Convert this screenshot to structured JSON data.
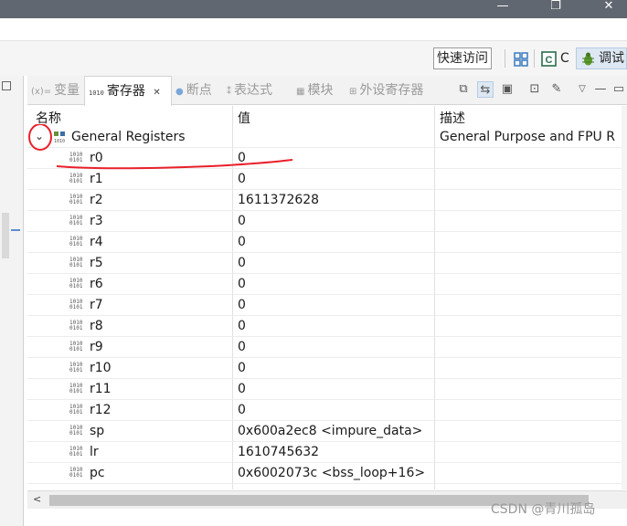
{
  "window": {
    "minimize": "—",
    "restore": "❐",
    "close": "✕"
  },
  "toolbar": {
    "quick_access": "快速访问",
    "perspectives": [
      {
        "icon": "c-perspective-icon",
        "label": "C"
      },
      {
        "icon": "debug-bug-icon",
        "label": "调试"
      }
    ]
  },
  "tabs": [
    {
      "icon": "(x)=",
      "label": "变量"
    },
    {
      "icon": "1010",
      "label": "寄存器",
      "close": "✕"
    },
    {
      "icon": "●",
      "label": "断点"
    },
    {
      "icon": "⁑",
      "label": "表达式"
    },
    {
      "icon": "▦",
      "label": "模块"
    },
    {
      "icon": "⊞",
      "label": "外设寄存器"
    }
  ],
  "table": {
    "headers": {
      "name": "名称",
      "value": "值",
      "description": "描述"
    },
    "group": {
      "expand_icon": "⌄",
      "name": "General Registers",
      "description": "General Purpose and FPU R"
    },
    "rows": [
      {
        "name": "r0",
        "value": "0"
      },
      {
        "name": "r1",
        "value": "0"
      },
      {
        "name": "r2",
        "value": "1611372628"
      },
      {
        "name": "r3",
        "value": "0"
      },
      {
        "name": "r4",
        "value": "0"
      },
      {
        "name": "r5",
        "value": "0"
      },
      {
        "name": "r6",
        "value": "0"
      },
      {
        "name": "r7",
        "value": "0"
      },
      {
        "name": "r8",
        "value": "0"
      },
      {
        "name": "r9",
        "value": "0"
      },
      {
        "name": "r10",
        "value": "0"
      },
      {
        "name": "r11",
        "value": "0"
      },
      {
        "name": "r12",
        "value": "0"
      },
      {
        "name": "sp",
        "value": "0x600a2ec8 <impure_data>"
      },
      {
        "name": "lr",
        "value": "1610745632"
      },
      {
        "name": "pc",
        "value": "0x6002073c <bss_loop+16>"
      }
    ]
  },
  "scroll": {
    "left_arrow": "<"
  },
  "watermark": "CSDN @青川孤岛",
  "colors": {
    "annotation_red": "#e8202a",
    "titlebar": "#616770",
    "grid": "#e1e1e1"
  }
}
